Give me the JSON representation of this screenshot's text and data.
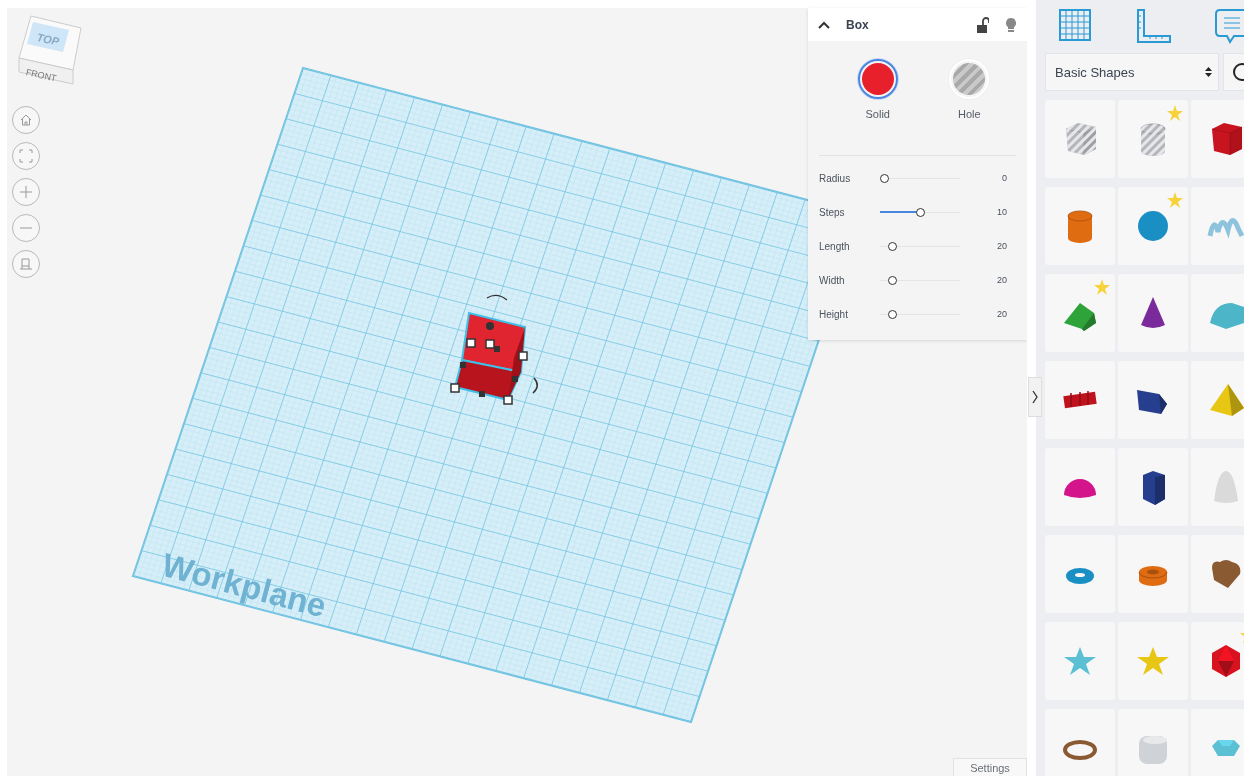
{
  "canvas": {
    "view_cube": {
      "top": "TOP",
      "front": "FRONT"
    },
    "nav_buttons": [
      {
        "kind": "home"
      },
      {
        "kind": "fit"
      },
      {
        "kind": "zoom-in"
      },
      {
        "kind": "zoom-out"
      },
      {
        "kind": "ortho"
      }
    ],
    "workplane_label": "Workplane",
    "settings_button": "Settings"
  },
  "inspector": {
    "title": "Box",
    "locked": false,
    "modes": [
      {
        "label": "Solid",
        "selected": true
      },
      {
        "label": "Hole",
        "selected": false
      }
    ],
    "params": [
      {
        "label": "Radius",
        "level": 0,
        "reading": "0"
      },
      {
        "label": "Steps",
        "level": 0.51,
        "reading": "10"
      },
      {
        "label": "Length",
        "level": 0.11,
        "reading": "20"
      },
      {
        "label": "Width",
        "level": 0.11,
        "reading": "20"
      },
      {
        "label": "Height",
        "level": 0.11,
        "reading": "20"
      }
    ]
  },
  "library": {
    "tools": [
      {
        "kind": "grid"
      },
      {
        "kind": "ruler"
      },
      {
        "kind": "notes"
      }
    ],
    "category": "Basic Shapes",
    "shapes": [
      {
        "kind": "box",
        "color": "#b4b6ba",
        "hole": true,
        "starred": false
      },
      {
        "kind": "cylinder",
        "color": "#b4b6ba",
        "hole": true,
        "starred": true
      },
      {
        "kind": "box",
        "color": "#c8141e",
        "hole": false,
        "starred": false
      },
      {
        "kind": "cylinder",
        "color": "#e06c12",
        "hole": false,
        "starred": false
      },
      {
        "kind": "sphere",
        "color": "#1a8fc4",
        "hole": false,
        "starred": true
      },
      {
        "kind": "scribble",
        "color": "#8ec3de",
        "hole": false,
        "starred": false
      },
      {
        "kind": "roof",
        "color": "#2ea33a",
        "hole": false,
        "starred": true
      },
      {
        "kind": "cone",
        "color": "#7a2a9a",
        "hole": false,
        "starred": false
      },
      {
        "kind": "round-roof",
        "color": "#4cb6c8",
        "hole": false,
        "starred": false
      },
      {
        "kind": "text",
        "color": "#c0121c",
        "hole": false,
        "starred": false
      },
      {
        "kind": "wedge",
        "color": "#253f8e",
        "hole": false,
        "starred": false
      },
      {
        "kind": "pyramid",
        "color": "#e8c614",
        "hole": false,
        "starred": false
      },
      {
        "kind": "half-sphere",
        "color": "#d4148a",
        "hole": false,
        "starred": false
      },
      {
        "kind": "polygon",
        "color": "#253f8e",
        "hole": false,
        "starred": false
      },
      {
        "kind": "paraboloid",
        "color": "#dadada",
        "hole": false,
        "starred": false
      },
      {
        "kind": "torus",
        "color": "#1a8fc4",
        "hole": false,
        "starred": false
      },
      {
        "kind": "tube",
        "color": "#e06c12",
        "hole": false,
        "starred": false
      },
      {
        "kind": "heart",
        "color": "#8a5a32",
        "hole": false,
        "starred": false
      },
      {
        "kind": "star",
        "color": "#5cc0d4",
        "hole": false,
        "starred": false
      },
      {
        "kind": "star",
        "color": "#e8c614",
        "hole": false,
        "starred": false
      },
      {
        "kind": "icosahedron",
        "color": "#d8121e",
        "hole": false,
        "starred": true
      },
      {
        "kind": "ring",
        "color": "#8a5a32",
        "hole": false,
        "starred": false
      },
      {
        "kind": "rounded-box",
        "color": "#cfd2d6",
        "hole": false,
        "starred": false
      },
      {
        "kind": "gem",
        "color": "#5cc0d4",
        "hole": false,
        "starred": false
      }
    ]
  }
}
